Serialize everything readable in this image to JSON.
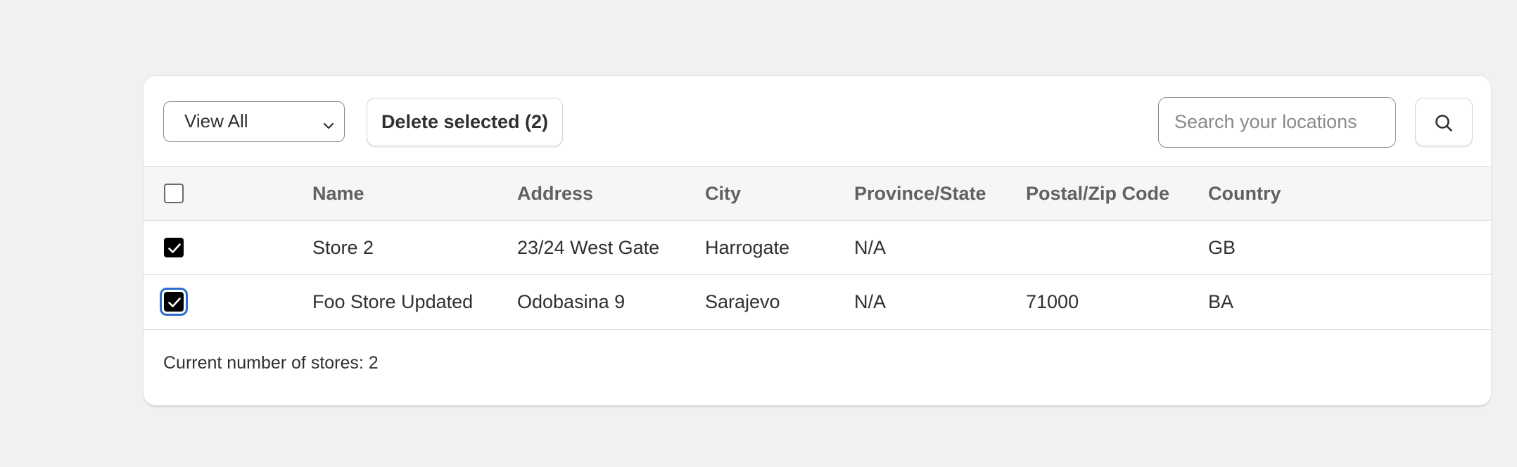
{
  "toolbar": {
    "filter_select": {
      "value": "View All"
    },
    "delete_label": "Delete selected (2)",
    "search": {
      "placeholder": "Search your locations"
    },
    "icons": {
      "select_chevron": "chevron-down-icon",
      "search_button": "search-icon"
    }
  },
  "table": {
    "headers": [
      "Name",
      "Address",
      "City",
      "Province/State",
      "Postal/Zip Code",
      "Country"
    ],
    "rows": [
      {
        "checked": true,
        "name": "Store 2",
        "address": "23/24 West Gate",
        "city": "Harrogate",
        "province": "N/A",
        "postal": "",
        "country": "GB"
      },
      {
        "checked": true,
        "focused": true,
        "name": "Foo Store Updated",
        "address": "Odobasina 9",
        "city": "Sarajevo",
        "province": "N/A",
        "postal": "71000",
        "country": "BA"
      }
    ]
  },
  "footer": {
    "store_count_text": "Current number of stores: 2"
  },
  "colors": {
    "page_background": "#f1f1f1",
    "card_background": "#ffffff",
    "header_row_background": "#f6f6f6",
    "checkbox_checked": "#000000",
    "focus_ring": "#2c6ecb"
  }
}
